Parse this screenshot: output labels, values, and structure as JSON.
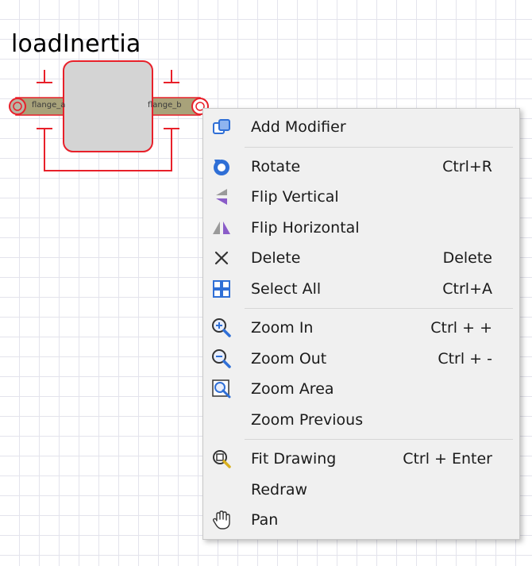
{
  "component": {
    "title": "loadInertia",
    "flange_left": "flange_a",
    "flange_right": "flange_b"
  },
  "menu": {
    "items": [
      {
        "label": "Add Modifier",
        "shortcut": "",
        "icon": "add-modifier-icon"
      },
      {
        "label": "Rotate",
        "shortcut": "Ctrl+R",
        "icon": "rotate-icon"
      },
      {
        "label": "Flip Vertical",
        "shortcut": "",
        "icon": "flip-vertical-icon"
      },
      {
        "label": "Flip Horizontal",
        "shortcut": "",
        "icon": "flip-horizontal-icon"
      },
      {
        "label": "Delete",
        "shortcut": "Delete",
        "icon": "delete-icon"
      },
      {
        "label": "Select All",
        "shortcut": "Ctrl+A",
        "icon": "select-all-icon"
      },
      {
        "label": "Zoom In",
        "shortcut": "Ctrl + +",
        "icon": "zoom-in-icon"
      },
      {
        "label": "Zoom Out",
        "shortcut": "Ctrl + -",
        "icon": "zoom-out-icon"
      },
      {
        "label": "Zoom Area",
        "shortcut": "",
        "icon": "zoom-area-icon"
      },
      {
        "label": "Zoom Previous",
        "shortcut": "",
        "icon": ""
      },
      {
        "label": "Fit Drawing",
        "shortcut": "Ctrl + Enter",
        "icon": "fit-drawing-icon"
      },
      {
        "label": "Redraw",
        "shortcut": "",
        "icon": ""
      },
      {
        "label": "Pan",
        "shortcut": "",
        "icon": "pan-hand-icon"
      }
    ]
  },
  "colors": {
    "selection_red": "#e8202a",
    "body_gray": "#d4d4d4",
    "shaft_olive": "#a8a27a",
    "icon_blue": "#2f6fd6",
    "icon_purple": "#8a5cc8"
  }
}
